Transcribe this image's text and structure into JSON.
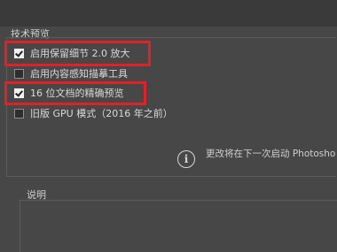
{
  "tech_preview": {
    "title": "技术预览",
    "options": [
      {
        "label": "启用保留细节 2.0 放大",
        "checked": true
      },
      {
        "label": "启用内容感知描摹工具",
        "checked": false
      },
      {
        "label": "16 位文档的精确预览",
        "checked": true
      },
      {
        "label": "旧版 GPU 模式（2016 年之前）",
        "checked": false
      }
    ]
  },
  "info": {
    "icon": "info-icon",
    "glyph": "i",
    "message": "更改将在下一次启动 Photosho"
  },
  "description": {
    "title": "说明"
  },
  "colors": {
    "highlight": "#e2202a"
  }
}
